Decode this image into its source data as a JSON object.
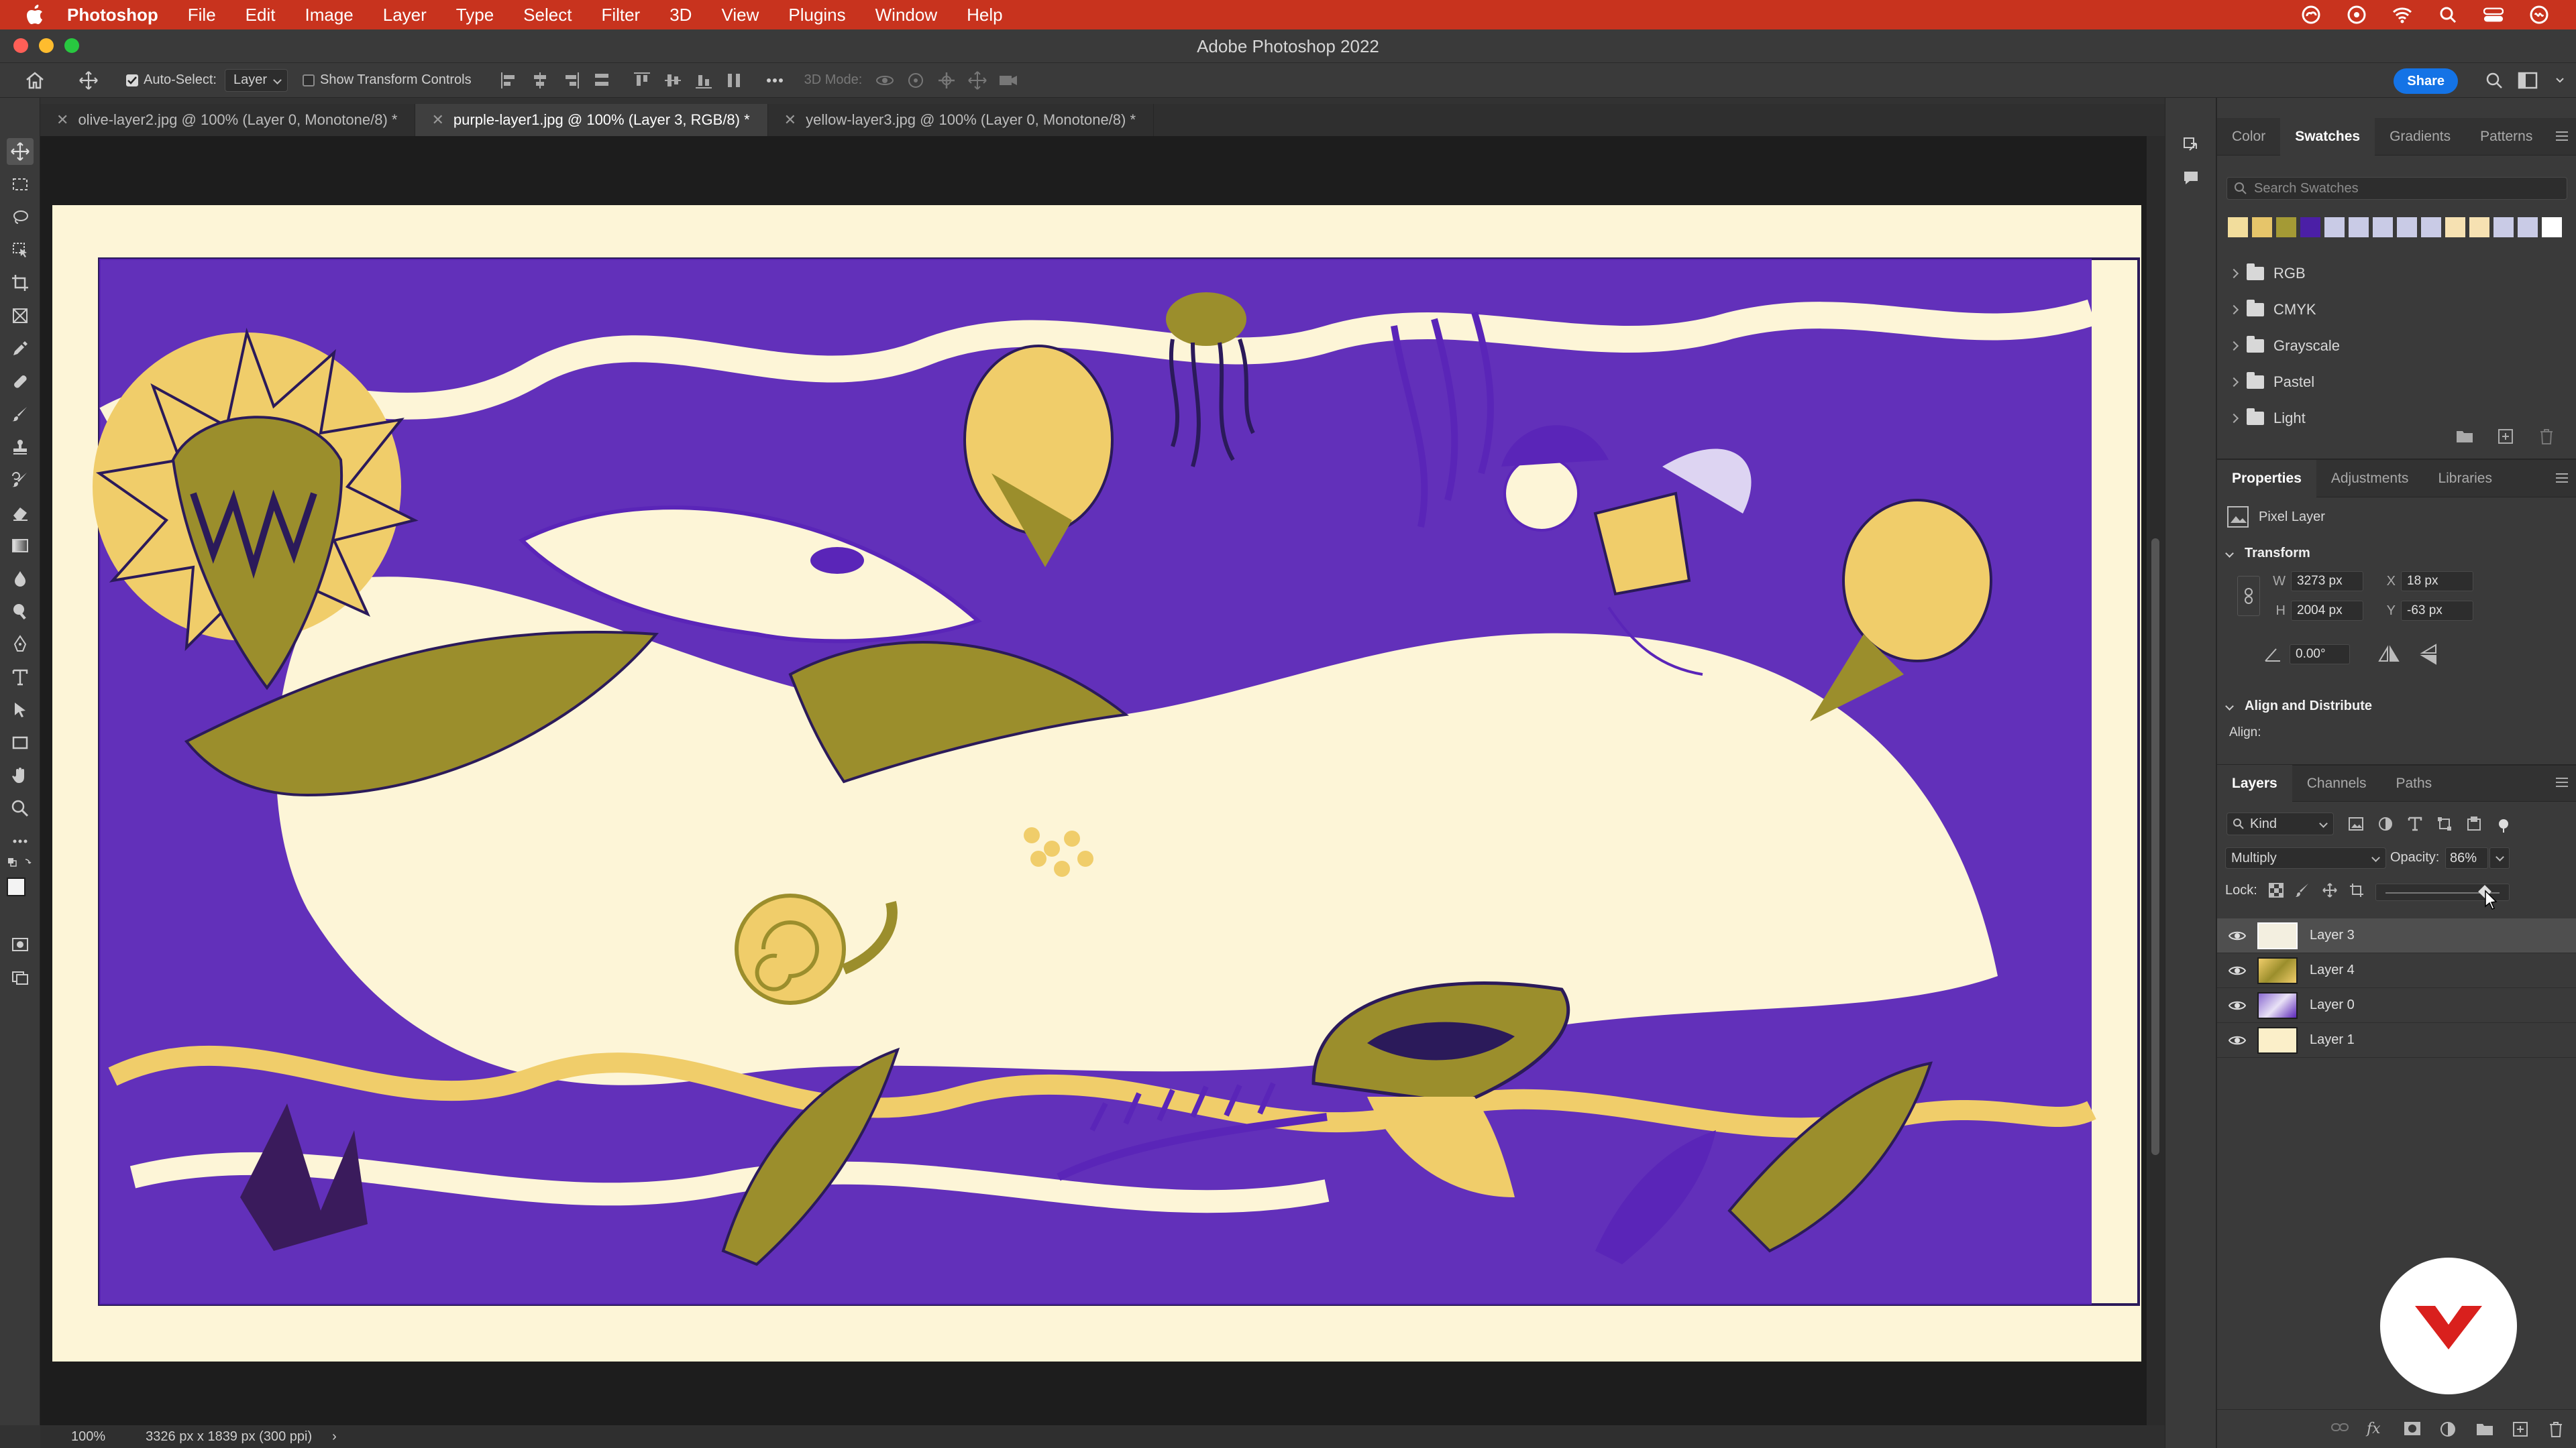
{
  "menubar": {
    "app": "Photoshop",
    "items": [
      "File",
      "Edit",
      "Image",
      "Layer",
      "Type",
      "Select",
      "Filter",
      "3D",
      "View",
      "Plugins",
      "Window",
      "Help"
    ]
  },
  "window": {
    "title": "Adobe Photoshop 2022"
  },
  "options": {
    "auto_select_label": "Auto-Select:",
    "auto_select_value": "Layer",
    "show_transform_label": "Show Transform Controls",
    "mode_3d_label": "3D Mode:",
    "share_label": "Share"
  },
  "tabs": [
    {
      "label": "olive-layer2.jpg @ 100% (Layer 0, Monotone/8) *",
      "active": false
    },
    {
      "label": "purple-layer1.jpg @ 100% (Layer 3, RGB/8) *",
      "active": true
    },
    {
      "label": "yellow-layer3.jpg @ 100% (Layer 0, Monotone/8) *",
      "active": false
    }
  ],
  "status": {
    "zoom": "100%",
    "doc_info": "3326 px x 1839 px (300 ppi)"
  },
  "swatches_panel": {
    "tabs": [
      "Color",
      "Swatches",
      "Gradients",
      "Patterns"
    ],
    "active_tab": "Swatches",
    "search_placeholder": "Search Swatches",
    "recent_colors": [
      "#f2dd9c",
      "#e6c56a",
      "#a49a35",
      "#4b1fa6",
      "#c9cbe6",
      "#c9cbe6",
      "#c9cbe6",
      "#c9cbe6",
      "#c9cbe6",
      "#f6e1b2",
      "#f6e1b2",
      "#c9cbe6",
      "#c9cbe6",
      "#ffffff"
    ],
    "groups": [
      "RGB",
      "CMYK",
      "Grayscale",
      "Pastel",
      "Light"
    ]
  },
  "properties_panel": {
    "tabs": [
      "Properties",
      "Adjustments",
      "Libraries"
    ],
    "active_tab": "Properties",
    "layer_type": "Pixel Layer",
    "transform_title": "Transform",
    "w_label": "W",
    "w_value": "3273 px",
    "h_label": "H",
    "h_value": "2004 px",
    "x_label": "X",
    "x_value": "18 px",
    "y_label": "Y",
    "y_value": "-63 px",
    "angle_value": "0.00°",
    "align_title": "Align and Distribute",
    "align_label": "Align:"
  },
  "layers_panel": {
    "tabs": [
      "Layers",
      "Channels",
      "Paths"
    ],
    "active_tab": "Layers",
    "kind_label": "Kind",
    "blend_mode": "Multiply",
    "opacity_label": "Opacity:",
    "opacity_value": "86%",
    "opacity_fraction": 0.86,
    "lock_label": "Lock:",
    "layers": [
      {
        "name": "Layer 3",
        "selected": true,
        "thumb": "#f3efe0"
      },
      {
        "name": "Layer 4",
        "selected": false,
        "thumb": "#c9bb6e"
      },
      {
        "name": "Layer 0",
        "selected": false,
        "thumb": "#8a6ad0"
      },
      {
        "name": "Layer 1",
        "selected": false,
        "thumb": "#fbefc9"
      }
    ]
  },
  "colors": {
    "menubar": "#c8331e",
    "accent": "#1473e6",
    "canvas_bg": "#fdf5d7",
    "purple": "#5a25b8",
    "olive": "#9b8e2c",
    "yellow": "#f0cd6a",
    "brand_red": "#d9201d"
  }
}
